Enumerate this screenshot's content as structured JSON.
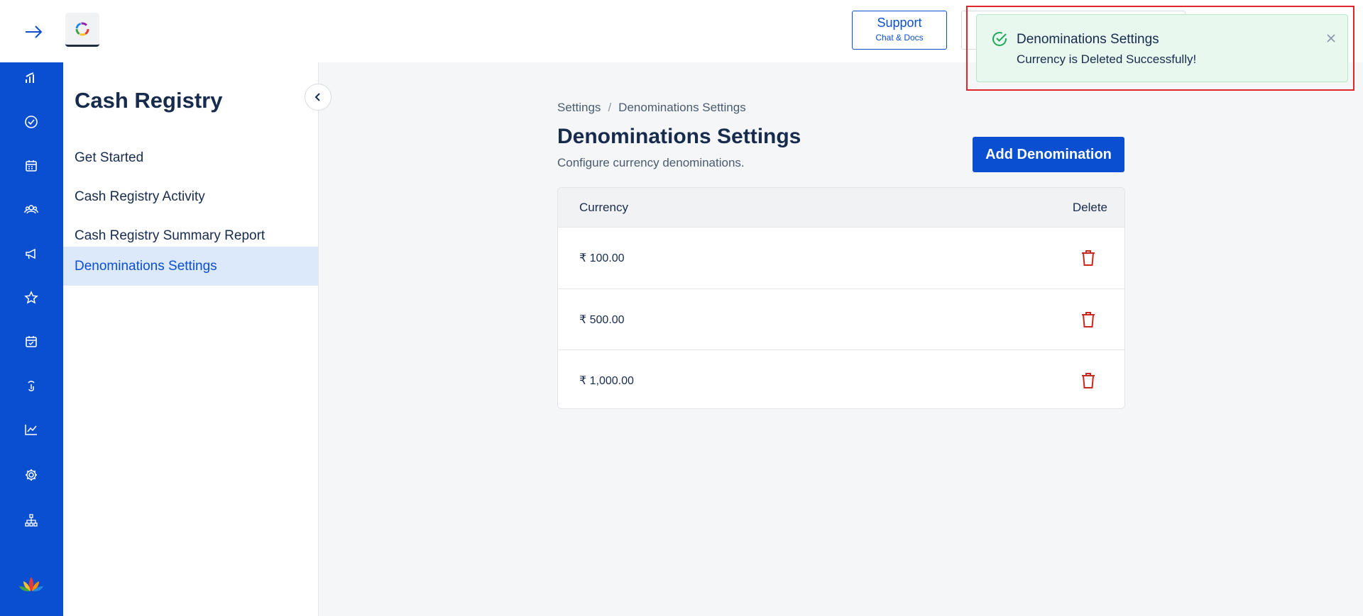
{
  "header": {
    "expand_icon": "arrow-right-icon",
    "logo_icon": "app-logo-icon",
    "support": {
      "label": "Support",
      "sublabel": "Chat & Docs"
    }
  },
  "rail": {
    "items": [
      {
        "icon": "bar-chart-icon"
      },
      {
        "icon": "check-circle-icon"
      },
      {
        "icon": "calendar-icon"
      },
      {
        "icon": "users-group-icon"
      },
      {
        "icon": "megaphone-icon"
      },
      {
        "icon": "star-icon"
      },
      {
        "icon": "calendar-check-icon"
      },
      {
        "icon": "touch-icon"
      },
      {
        "icon": "trend-chart-icon"
      },
      {
        "icon": "gear-icon"
      },
      {
        "icon": "org-chart-icon"
      },
      {
        "icon": "lotus-logo-icon"
      }
    ]
  },
  "sidebar": {
    "title": "Cash Registry",
    "items": [
      {
        "label": "Get Started",
        "active": false
      },
      {
        "label": "Cash Registry Activity",
        "active": false
      },
      {
        "label": "Cash Registry Summary Report",
        "active": false
      },
      {
        "label": "Denominations Settings",
        "active": true
      }
    ],
    "collapse_icon": "chevron-left-icon"
  },
  "main": {
    "breadcrumb": {
      "parent": "Settings",
      "separator": "/",
      "current": "Denominations Settings"
    },
    "title": "Denominations Settings",
    "subtitle": "Configure currency denominations.",
    "add_button": "Add Denomination",
    "table": {
      "columns": [
        "Currency",
        "Delete"
      ],
      "rows": [
        {
          "currency": "₹ 100.00"
        },
        {
          "currency": "₹ 500.00"
        },
        {
          "currency": "₹ 1,000.00"
        }
      ],
      "delete_icon": "trash-icon"
    }
  },
  "toast": {
    "title": "Denominations Settings",
    "message": "Currency is Deleted Successfully!",
    "icon": "check-circle-icon",
    "close_icon": "close-icon"
  },
  "colors": {
    "primary": "#0b4fd1",
    "delete": "#c8281e",
    "toast_bg": "#e9f8ef",
    "success": "#22a85a",
    "highlight": "#e0262b"
  }
}
